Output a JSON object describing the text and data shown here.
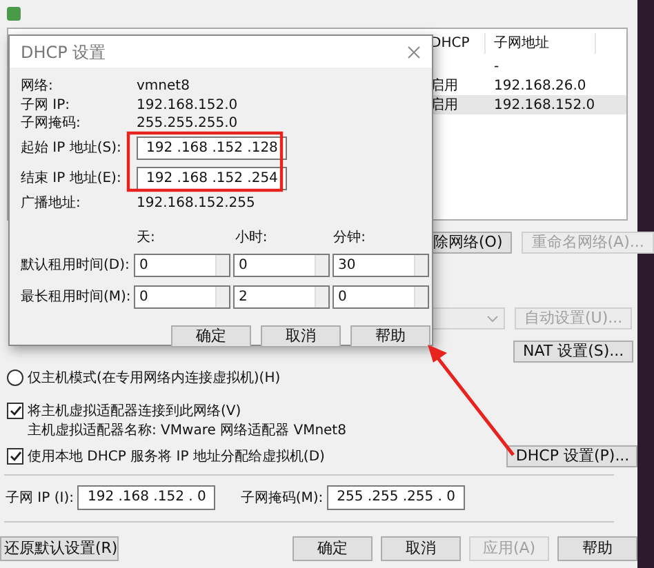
{
  "editor": {
    "table": {
      "columns": [
        "DHCP",
        "子网地址"
      ],
      "rows": [
        {
          "subnet": "-",
          "selected": false
        },
        {
          "dhcp": "启用",
          "subnet": "192.168.26.0",
          "selected": false
        },
        {
          "dhcp": "启用",
          "subnet": "192.168.152.0",
          "selected": true
        }
      ]
    },
    "network_buttons": [
      {
        "label": "除网络(O)",
        "disabled": false
      },
      {
        "label": "重命名网络(A)...",
        "disabled": true
      }
    ],
    "mode_dropdown": {
      "disabled": true
    },
    "auto_button": {
      "label": "自动设置(U)...",
      "disabled": true
    },
    "nat_button": {
      "label": "NAT 设置(S)...",
      "disabled": false
    },
    "host_only_radio": {
      "label": "仅主机模式(在专用网络内连接虚拟机)(H)",
      "selected": false
    },
    "connect_adapter": {
      "label": "将主机虚拟适配器连接到此网络(V)",
      "checked": true
    },
    "adapter_name": "主机虚拟适配器名称: VMware 网络适配器 VMnet8",
    "use_dhcp": {
      "label": "使用本地 DHCP 服务将 IP 地址分配给虚拟机(D)",
      "checked": true
    },
    "dhcp_button": {
      "label": "DHCP 设置(P)...",
      "disabled": false
    },
    "subnet_ip": {
      "label": "子网 IP (I):",
      "value": "192 .168 .152 . 0"
    },
    "subnet_mask": {
      "label": "子网掩码(M):",
      "value": "255 .255 .255 . 0"
    },
    "footer_buttons": [
      {
        "label": "还原默认设置(R)",
        "disabled": false
      },
      {
        "label": "确定",
        "disabled": false
      },
      {
        "label": "取消",
        "disabled": false
      },
      {
        "label": "应用(A)",
        "disabled": true
      },
      {
        "label": "帮助",
        "disabled": false
      }
    ]
  },
  "dhcp_dialog": {
    "title": "DHCP 设置",
    "info": [
      {
        "kind": "text",
        "label": "网络:",
        "value": "vmnet8"
      },
      {
        "kind": "text",
        "label": "子网 IP:",
        "value": "192.168.152.0"
      },
      {
        "kind": "text",
        "label": "子网掩码:",
        "value": "255.255.255.0"
      },
      {
        "kind": "field",
        "label": "起始 IP 地址(S):",
        "value": "192 .168 .152 .128"
      },
      {
        "kind": "field",
        "label": "结束 IP 地址(E):",
        "value": "192 .168 .152 .254"
      },
      {
        "kind": "text",
        "label": "广播地址:",
        "value": "192.168.152.255"
      }
    ],
    "lease": {
      "columns": [
        "天:",
        "小时:",
        "分钟:"
      ],
      "rows": [
        {
          "label": "默认租用时间(D):",
          "values": [
            "0",
            "0",
            "30"
          ]
        },
        {
          "label": "最长租用时间(M):",
          "values": [
            "0",
            "2",
            "0"
          ]
        }
      ]
    },
    "buttons": [
      "确定",
      "取消",
      "帮助"
    ]
  }
}
